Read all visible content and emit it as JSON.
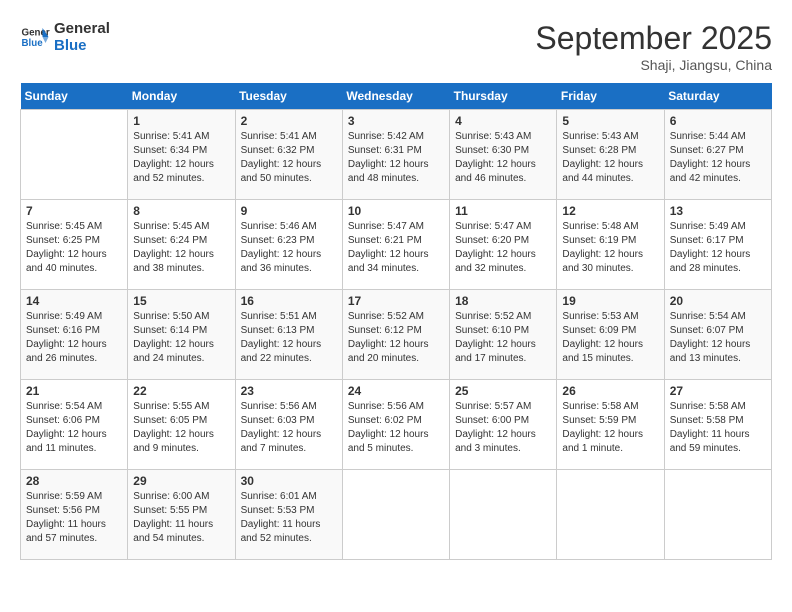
{
  "header": {
    "logo_general": "General",
    "logo_blue": "Blue",
    "month_title": "September 2025",
    "subtitle": "Shaji, Jiangsu, China"
  },
  "weekdays": [
    "Sunday",
    "Monday",
    "Tuesday",
    "Wednesday",
    "Thursday",
    "Friday",
    "Saturday"
  ],
  "weeks": [
    [
      {
        "day": "",
        "info": ""
      },
      {
        "day": "1",
        "info": "Sunrise: 5:41 AM\nSunset: 6:34 PM\nDaylight: 12 hours\nand 52 minutes."
      },
      {
        "day": "2",
        "info": "Sunrise: 5:41 AM\nSunset: 6:32 PM\nDaylight: 12 hours\nand 50 minutes."
      },
      {
        "day": "3",
        "info": "Sunrise: 5:42 AM\nSunset: 6:31 PM\nDaylight: 12 hours\nand 48 minutes."
      },
      {
        "day": "4",
        "info": "Sunrise: 5:43 AM\nSunset: 6:30 PM\nDaylight: 12 hours\nand 46 minutes."
      },
      {
        "day": "5",
        "info": "Sunrise: 5:43 AM\nSunset: 6:28 PM\nDaylight: 12 hours\nand 44 minutes."
      },
      {
        "day": "6",
        "info": "Sunrise: 5:44 AM\nSunset: 6:27 PM\nDaylight: 12 hours\nand 42 minutes."
      }
    ],
    [
      {
        "day": "7",
        "info": "Sunrise: 5:45 AM\nSunset: 6:25 PM\nDaylight: 12 hours\nand 40 minutes."
      },
      {
        "day": "8",
        "info": "Sunrise: 5:45 AM\nSunset: 6:24 PM\nDaylight: 12 hours\nand 38 minutes."
      },
      {
        "day": "9",
        "info": "Sunrise: 5:46 AM\nSunset: 6:23 PM\nDaylight: 12 hours\nand 36 minutes."
      },
      {
        "day": "10",
        "info": "Sunrise: 5:47 AM\nSunset: 6:21 PM\nDaylight: 12 hours\nand 34 minutes."
      },
      {
        "day": "11",
        "info": "Sunrise: 5:47 AM\nSunset: 6:20 PM\nDaylight: 12 hours\nand 32 minutes."
      },
      {
        "day": "12",
        "info": "Sunrise: 5:48 AM\nSunset: 6:19 PM\nDaylight: 12 hours\nand 30 minutes."
      },
      {
        "day": "13",
        "info": "Sunrise: 5:49 AM\nSunset: 6:17 PM\nDaylight: 12 hours\nand 28 minutes."
      }
    ],
    [
      {
        "day": "14",
        "info": "Sunrise: 5:49 AM\nSunset: 6:16 PM\nDaylight: 12 hours\nand 26 minutes."
      },
      {
        "day": "15",
        "info": "Sunrise: 5:50 AM\nSunset: 6:14 PM\nDaylight: 12 hours\nand 24 minutes."
      },
      {
        "day": "16",
        "info": "Sunrise: 5:51 AM\nSunset: 6:13 PM\nDaylight: 12 hours\nand 22 minutes."
      },
      {
        "day": "17",
        "info": "Sunrise: 5:52 AM\nSunset: 6:12 PM\nDaylight: 12 hours\nand 20 minutes."
      },
      {
        "day": "18",
        "info": "Sunrise: 5:52 AM\nSunset: 6:10 PM\nDaylight: 12 hours\nand 17 minutes."
      },
      {
        "day": "19",
        "info": "Sunrise: 5:53 AM\nSunset: 6:09 PM\nDaylight: 12 hours\nand 15 minutes."
      },
      {
        "day": "20",
        "info": "Sunrise: 5:54 AM\nSunset: 6:07 PM\nDaylight: 12 hours\nand 13 minutes."
      }
    ],
    [
      {
        "day": "21",
        "info": "Sunrise: 5:54 AM\nSunset: 6:06 PM\nDaylight: 12 hours\nand 11 minutes."
      },
      {
        "day": "22",
        "info": "Sunrise: 5:55 AM\nSunset: 6:05 PM\nDaylight: 12 hours\nand 9 minutes."
      },
      {
        "day": "23",
        "info": "Sunrise: 5:56 AM\nSunset: 6:03 PM\nDaylight: 12 hours\nand 7 minutes."
      },
      {
        "day": "24",
        "info": "Sunrise: 5:56 AM\nSunset: 6:02 PM\nDaylight: 12 hours\nand 5 minutes."
      },
      {
        "day": "25",
        "info": "Sunrise: 5:57 AM\nSunset: 6:00 PM\nDaylight: 12 hours\nand 3 minutes."
      },
      {
        "day": "26",
        "info": "Sunrise: 5:58 AM\nSunset: 5:59 PM\nDaylight: 12 hours\nand 1 minute."
      },
      {
        "day": "27",
        "info": "Sunrise: 5:58 AM\nSunset: 5:58 PM\nDaylight: 11 hours\nand 59 minutes."
      }
    ],
    [
      {
        "day": "28",
        "info": "Sunrise: 5:59 AM\nSunset: 5:56 PM\nDaylight: 11 hours\nand 57 minutes."
      },
      {
        "day": "29",
        "info": "Sunrise: 6:00 AM\nSunset: 5:55 PM\nDaylight: 11 hours\nand 54 minutes."
      },
      {
        "day": "30",
        "info": "Sunrise: 6:01 AM\nSunset: 5:53 PM\nDaylight: 11 hours\nand 52 minutes."
      },
      {
        "day": "",
        "info": ""
      },
      {
        "day": "",
        "info": ""
      },
      {
        "day": "",
        "info": ""
      },
      {
        "day": "",
        "info": ""
      }
    ]
  ]
}
